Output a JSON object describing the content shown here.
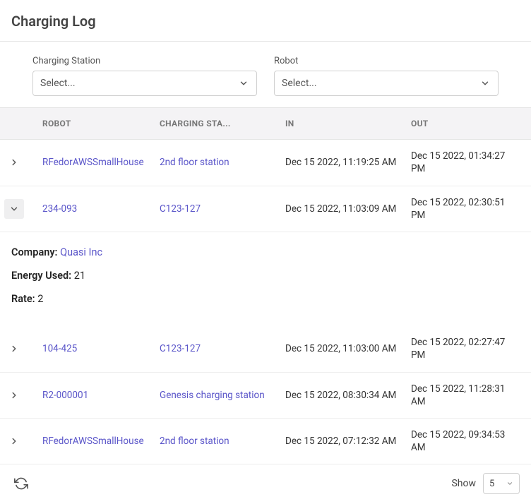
{
  "title": "Charging Log",
  "filters": {
    "station": {
      "label": "Charging Station",
      "placeholder": "Select..."
    },
    "robot": {
      "label": "Robot",
      "placeholder": "Select..."
    }
  },
  "columns": {
    "robot": "ROBOT",
    "station": "CHARGING STA...",
    "in": "IN",
    "out": "OUT"
  },
  "rows": [
    {
      "robot": "RFedorAWSSmallHouse",
      "station": "2nd floor station",
      "in": "Dec 15 2022, 11:19:25 AM",
      "out": "Dec 15 2022, 01:34:27 PM"
    },
    {
      "robot": "234-093",
      "station": "C123-127",
      "in": "Dec 15 2022, 11:03:09 AM",
      "out": "Dec 15 2022, 02:30:51 PM"
    },
    {
      "robot": "104-425",
      "station": "C123-127",
      "in": "Dec 15 2022, 11:03:00 AM",
      "out": "Dec 15 2022, 02:27:47 PM"
    },
    {
      "robot": "R2-000001",
      "station": "Genesis charging station",
      "in": "Dec 15 2022, 08:30:34 AM",
      "out": "Dec 15 2022, 11:28:31 AM"
    },
    {
      "robot": "RFedorAWSSmallHouse",
      "station": "2nd floor station",
      "in": "Dec 15 2022, 07:12:32 AM",
      "out": "Dec 15 2022, 09:34:53 AM"
    }
  ],
  "detail": {
    "company_label": "Company:",
    "company_value": "Quasi Inc",
    "energy_label": "Energy Used:",
    "energy_value": "21",
    "rate_label": "Rate:",
    "rate_value": "2"
  },
  "pagination": {
    "show_label": "Show",
    "page_size": "5"
  }
}
